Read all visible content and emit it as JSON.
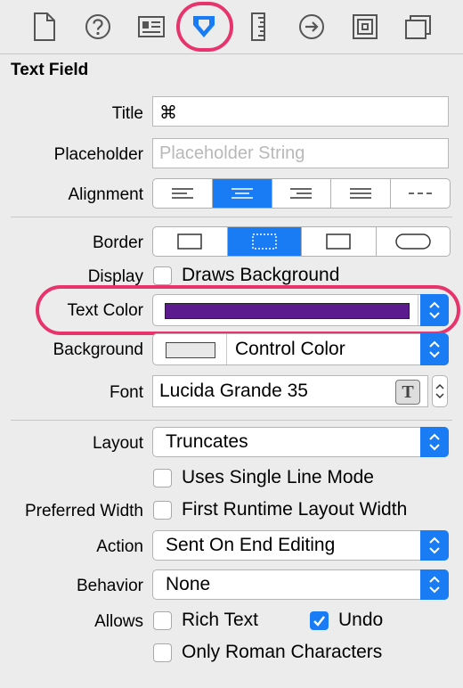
{
  "toolbar": {
    "icons": [
      "file-inspector-icon",
      "quick-help-icon",
      "identity-icon",
      "attributes-icon",
      "size-icon",
      "connections-icon",
      "bindings-icon",
      "view-effects-icon"
    ],
    "selected": "attributes-icon"
  },
  "section": {
    "title": "Text Field"
  },
  "fields": {
    "title": {
      "label": "Title",
      "value": "⌘"
    },
    "placeholder": {
      "label": "Placeholder",
      "value": "",
      "placeholder": "Placeholder String"
    },
    "alignment": {
      "label": "Alignment",
      "selected_index": 1
    },
    "border": {
      "label": "Border",
      "selected_index": 1
    },
    "display": {
      "label": "Display",
      "checkbox": "Draws Background",
      "checked": false
    },
    "text_color": {
      "label": "Text Color",
      "swatch": "#5b1a8e"
    },
    "background": {
      "label": "Background",
      "swatch": "#e8e8e8",
      "value": "Control Color"
    },
    "font": {
      "label": "Font",
      "value": "Lucida Grande 35"
    },
    "layout": {
      "label": "Layout",
      "value": "Truncates"
    },
    "single_line": {
      "checkbox": "Uses Single Line Mode",
      "checked": false
    },
    "preferred_width": {
      "label": "Preferred Width",
      "checkbox": "First Runtime Layout Width",
      "checked": false
    },
    "action": {
      "label": "Action",
      "value": "Sent On End Editing"
    },
    "behavior": {
      "label": "Behavior",
      "value": "None"
    },
    "allows": {
      "label": "Allows",
      "rich_text": {
        "label": "Rich Text",
        "checked": false
      },
      "undo": {
        "label": "Undo",
        "checked": true
      },
      "roman": {
        "label": "Only Roman Characters",
        "checked": false
      }
    }
  },
  "colors": {
    "accent": "#1a7cf5",
    "highlight": "#e8346c"
  }
}
